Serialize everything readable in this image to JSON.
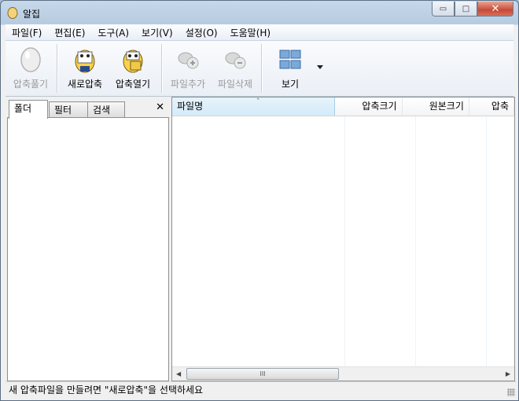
{
  "window": {
    "title": "알집",
    "minimize_glyph": "▭",
    "maximize_glyph": "□",
    "close_glyph": "✕"
  },
  "menu": [
    {
      "label": "파일(F)"
    },
    {
      "label": "편집(E)"
    },
    {
      "label": "도구(A)"
    },
    {
      "label": "보기(V)"
    },
    {
      "label": "설정(O)"
    },
    {
      "label": "도움말(H)"
    }
  ],
  "toolbar": {
    "extract": {
      "label": "압축풀기",
      "icon": "egg-icon",
      "enabled": false
    },
    "new_archive": {
      "label": "새로압축",
      "icon": "new-archive-icon",
      "enabled": true
    },
    "open_archive": {
      "label": "압축열기",
      "icon": "open-archive-icon",
      "enabled": true
    },
    "add_file": {
      "label": "파일추가",
      "icon": "add-file-icon",
      "enabled": false
    },
    "delete_file": {
      "label": "파일삭제",
      "icon": "delete-file-icon",
      "enabled": false
    },
    "view": {
      "label": "보기",
      "icon": "view-grid-icon",
      "enabled": true
    }
  },
  "left_panel": {
    "tabs": [
      {
        "label": "폴더",
        "active": true
      },
      {
        "label": "필터",
        "active": false
      },
      {
        "label": "검색",
        "active": false
      }
    ],
    "close_glyph": "✕"
  },
  "file_list": {
    "columns": [
      {
        "label": "파일명",
        "sorted": true
      },
      {
        "label": "압축크기"
      },
      {
        "label": "원본크기"
      },
      {
        "label": "압축"
      }
    ],
    "rows": [],
    "scroll_thumb_glyph": "III"
  },
  "status": {
    "text": "새 압축파일을 만들려면 \"새로압축\"을 선택하세요"
  },
  "colors": {
    "title_gradient_top": "#c6d8ea",
    "close_button": "#c74a36",
    "sorted_column": "#d4ebf9"
  }
}
